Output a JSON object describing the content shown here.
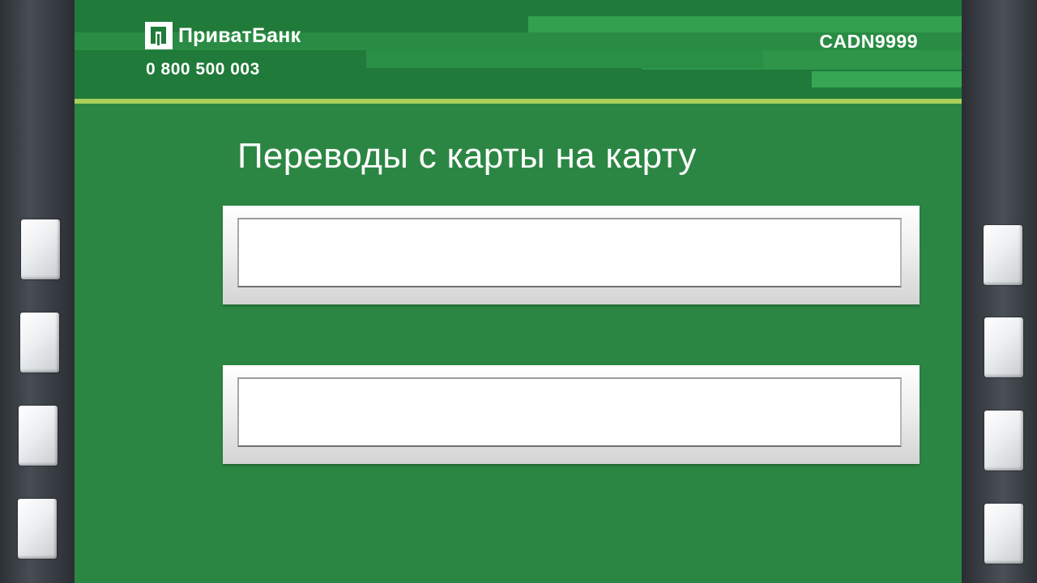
{
  "header": {
    "bank_name": "ПриватБанк",
    "phone": "0 800 500 003",
    "terminal_id": "CADN9999",
    "colors": {
      "screen_green": "#2c8643",
      "header_green": "#207a3a",
      "accent_line": "#a9d05a"
    },
    "logo_icon": "privatbank-logo-icon"
  },
  "main": {
    "title": "Переводы с карты на карту",
    "options": [
      {
        "label": ""
      },
      {
        "label": ""
      }
    ]
  },
  "side_keys": {
    "left": [
      "",
      "",
      "",
      ""
    ],
    "right": [
      "",
      "",
      "",
      ""
    ]
  }
}
